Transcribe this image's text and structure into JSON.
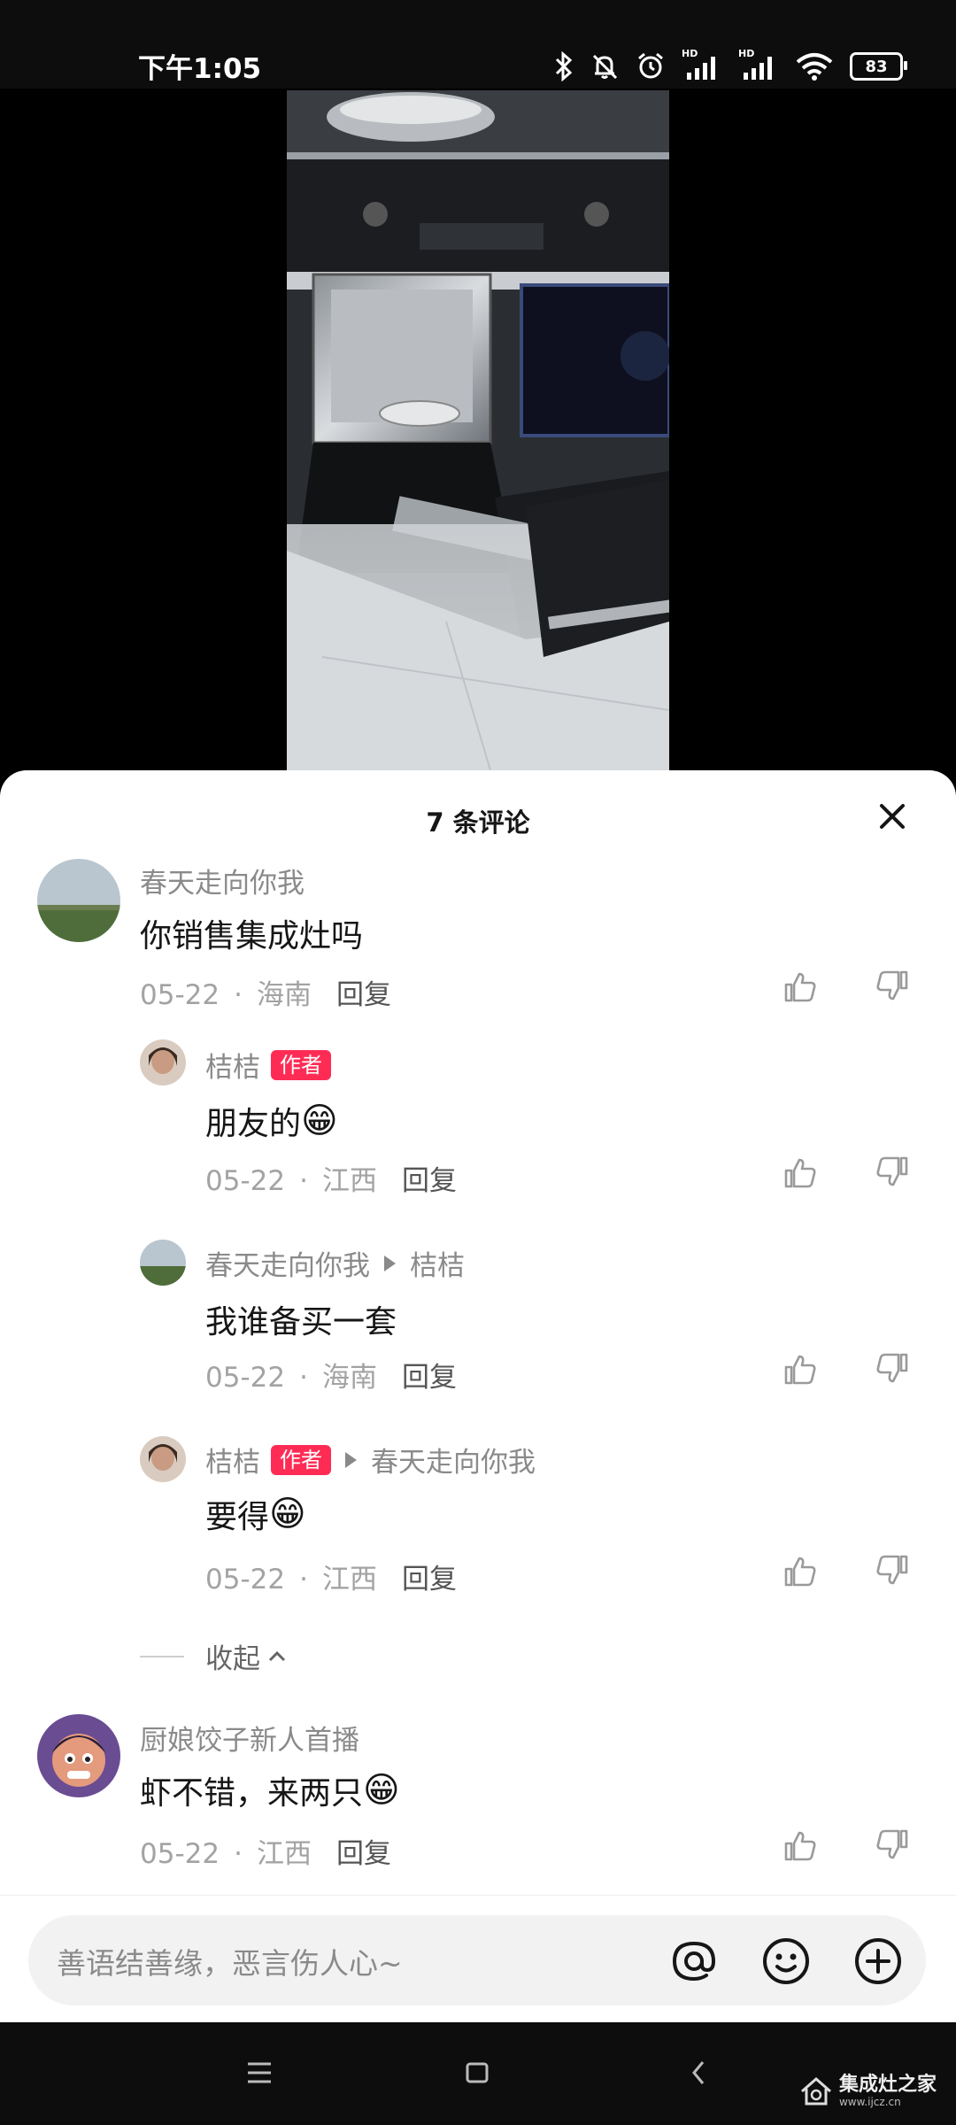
{
  "status": {
    "time": "下午1:05",
    "battery": "83",
    "hd1": "HD",
    "hd2": "HD"
  },
  "sheet": {
    "title": "7 条评论"
  },
  "comments": [
    {
      "user": "春天走向你我",
      "text": "你销售集成灶吗",
      "date": "05-22",
      "location": "海南",
      "reply": "回复"
    },
    {
      "user": "桔桔",
      "badge": "作者",
      "text": "朋友的",
      "emoji": "😁",
      "date": "05-22",
      "location": "江西",
      "reply": "回复"
    },
    {
      "user": "春天走向你我",
      "reply_to": "桔桔",
      "text": "我谁备买一套",
      "date": "05-22",
      "location": "海南",
      "reply": "回复"
    },
    {
      "user": "桔桔",
      "badge": "作者",
      "reply_to": "春天走向你我",
      "text": "要得",
      "emoji": "😁",
      "date": "05-22",
      "location": "江西",
      "reply": "回复"
    },
    {
      "user": "厨娘饺子新人首播",
      "text": "虾不错，来两只",
      "emoji": "😁",
      "date": "05-22",
      "location": "江西",
      "reply": "回复"
    }
  ],
  "collapse_label": "收起",
  "input": {
    "placeholder": "善语结善缘，恶言伤人心~"
  },
  "watermark": {
    "text": "集成灶之家",
    "sub": "www.ijcz.cn"
  },
  "colors": {
    "accent": "#fe2c55",
    "sheet_bg": "#ffffff",
    "text_primary": "#161616",
    "text_secondary": "#8a8a8a"
  }
}
